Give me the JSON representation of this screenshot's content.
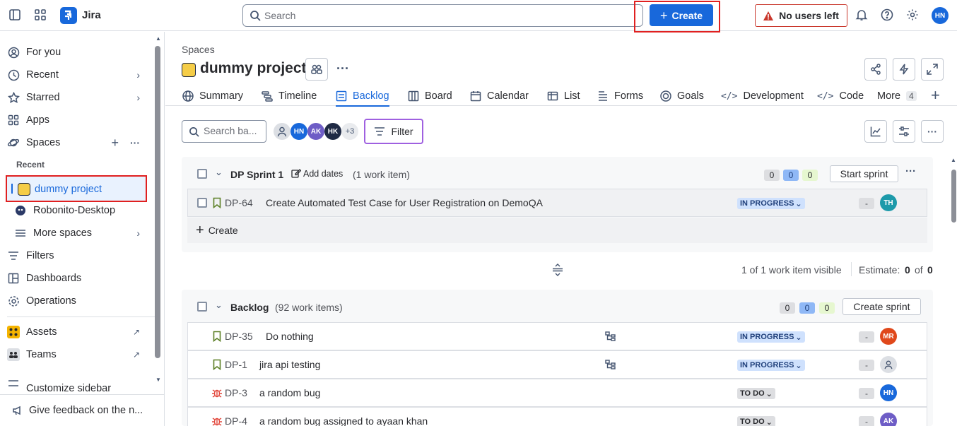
{
  "app": {
    "name": "Jira"
  },
  "topbar": {
    "search_placeholder": "Search",
    "create_label": "Create",
    "no_users_label": "No users left",
    "user_initials": "HN"
  },
  "sidebar": {
    "for_you": "For you",
    "recent": "Recent",
    "starred": "Starred",
    "apps": "Apps",
    "spaces": "Spaces",
    "recent_header": "Recent",
    "project_selected": "dummy project",
    "project_other": "Robonito-Desktop",
    "more_spaces": "More spaces",
    "filters": "Filters",
    "dashboards": "Dashboards",
    "operations": "Operations",
    "assets": "Assets",
    "teams": "Teams",
    "customize": "Customize sidebar",
    "feedback": "Give feedback on the n..."
  },
  "header": {
    "breadcrumb": "Spaces",
    "title": "dummy project"
  },
  "tabs": {
    "summary": "Summary",
    "timeline": "Timeline",
    "backlog": "Backlog",
    "board": "Board",
    "calendar": "Calendar",
    "list": "List",
    "forms": "Forms",
    "goals": "Goals",
    "development": "Development",
    "code": "Code",
    "more": "More",
    "more_count": "4"
  },
  "toolbar": {
    "search_placeholder": "Search ba...",
    "avatars": [
      "HN",
      "AK",
      "HK"
    ],
    "avatar_extra": "+3",
    "filter_label": "Filter"
  },
  "sprint": {
    "name": "DP Sprint 1",
    "add_dates": "Add dates",
    "count": "(1 work item)",
    "points": [
      "0",
      "0",
      "0"
    ],
    "start_label": "Start sprint",
    "create_label": "Create",
    "item": {
      "key": "DP-64",
      "summary": "Create Automated Test Case for User Registration on DemoQA",
      "status": "IN PROGRESS",
      "estimate": "-",
      "assignee": "TH"
    }
  },
  "visibility": {
    "text": "1 of 1 work item visible",
    "estimate_label": "Estimate:",
    "estimate_a": "0",
    "of": "of",
    "estimate_b": "0"
  },
  "backlog": {
    "name": "Backlog",
    "count": "(92 work items)",
    "points": [
      "0",
      "0",
      "0"
    ],
    "create_sprint_label": "Create sprint",
    "items": [
      {
        "key": "DP-35",
        "summary": "Do nothing",
        "status": "IN PROGRESS",
        "estimate": "-",
        "assignee": "MR"
      },
      {
        "key": "DP-1",
        "summary": "jira api testing",
        "status": "IN PROGRESS",
        "estimate": "-",
        "assignee": ""
      },
      {
        "key": "DP-3",
        "summary": "a random bug",
        "status": "TO DO",
        "estimate": "-",
        "assignee": "HN"
      },
      {
        "key": "DP-4",
        "summary": "a random bug assigned to ayaan khan",
        "status": "TO DO",
        "estimate": "-",
        "assignee": "AK"
      }
    ]
  }
}
